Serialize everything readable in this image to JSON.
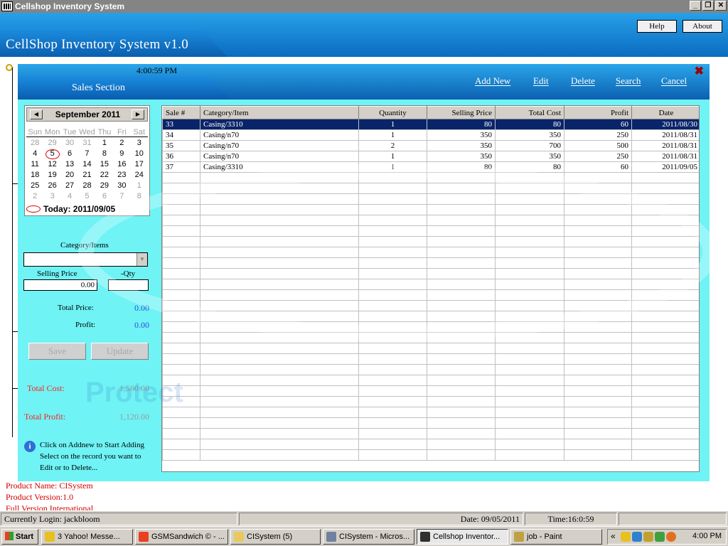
{
  "window": {
    "title": "Cellshop Inventory System"
  },
  "header": {
    "app_title": "CellShop Inventory System v1.0",
    "help": "Help",
    "about": "About"
  },
  "panel": {
    "time": "4:00:59 PM",
    "section_title": "Sales Section",
    "toolbar": {
      "add_new": "Add New",
      "edit": "Edit",
      "delete": "Delete",
      "search": "Search",
      "cancel": "Cancel"
    }
  },
  "calendar": {
    "month": "September 2011",
    "days_of_week": [
      "Sun",
      "Mon",
      "Tue",
      "Wed",
      "Thu",
      "Fri",
      "Sat"
    ],
    "weeks": [
      [
        "28",
        "29",
        "30",
        "31",
        "1",
        "2",
        "3"
      ],
      [
        "4",
        "5",
        "6",
        "7",
        "8",
        "9",
        "10"
      ],
      [
        "11",
        "12",
        "13",
        "14",
        "15",
        "16",
        "17"
      ],
      [
        "18",
        "19",
        "20",
        "21",
        "22",
        "23",
        "24"
      ],
      [
        "25",
        "26",
        "27",
        "28",
        "29",
        "30",
        "1"
      ],
      [
        "2",
        "3",
        "4",
        "5",
        "6",
        "7",
        "8"
      ]
    ],
    "selected_day": "5",
    "today_label": "Today: 2011/09/05"
  },
  "form": {
    "category_label": "Category/Items",
    "category_value": "",
    "selling_price_label": "Selling Price",
    "selling_price_value": "0.00",
    "qty_label": "-Qty",
    "qty_value": "",
    "total_price_label": "Total Price:",
    "total_price_value": "0.00",
    "profit_label": "Profit:",
    "profit_value": "0.00",
    "save": "Save",
    "update": "Update"
  },
  "totals": {
    "total_cost_label": "Total Cost:",
    "total_cost_value": "1,560.00",
    "total_profit_label": "Total Profit:",
    "total_profit_value": "1,120.00"
  },
  "info": {
    "lines": [
      "Click on Addnew to Start Adding",
      "Select on the record you want to",
      "Edit or to Delete..."
    ]
  },
  "table": {
    "columns": [
      "Sale #",
      "Category/Item",
      "Quantity",
      "Selling Price",
      "Total Cost",
      "Profit",
      "Date"
    ],
    "rows": [
      [
        "33",
        "Casing/3310",
        "1",
        "80",
        "80",
        "60",
        "2011/08/30"
      ],
      [
        "34",
        "Casing/n70",
        "1",
        "350",
        "350",
        "250",
        "2011/08/31"
      ],
      [
        "35",
        "Casing/n70",
        "2",
        "350",
        "700",
        "500",
        "2011/08/31"
      ],
      [
        "36",
        "Casing/n70",
        "1",
        "350",
        "350",
        "250",
        "2011/08/31"
      ],
      [
        "37",
        "Casing/3310",
        "1",
        "80",
        "80",
        "60",
        "2011/09/05"
      ]
    ],
    "selected_row": 0
  },
  "watermark": {
    "text": "Protect"
  },
  "product": {
    "name": "Product Name:   CISystem",
    "version": "Product Version:1.0",
    "extra": "Full Version International"
  },
  "statusbar": {
    "login": "Currently Login: jackbloom",
    "date": "Date: 09/05/2011",
    "time": "Time:16:0:59"
  },
  "taskbar": {
    "start": "Start",
    "tasks": [
      {
        "label": "3 Yahoo! Messe...",
        "color": "#e8c020"
      },
      {
        "label": "GSMSandwich © - ...",
        "color": "#e84020"
      },
      {
        "label": "CISystem (5)",
        "color": "#e8c860"
      },
      {
        "label": "CISystem - Micros...",
        "color": "#7080a0"
      },
      {
        "label": "Cellshop Inventor...",
        "color": "#303030"
      },
      {
        "label": "job - Paint",
        "color": "#c0a040"
      }
    ],
    "clock": "4:00 PM"
  }
}
